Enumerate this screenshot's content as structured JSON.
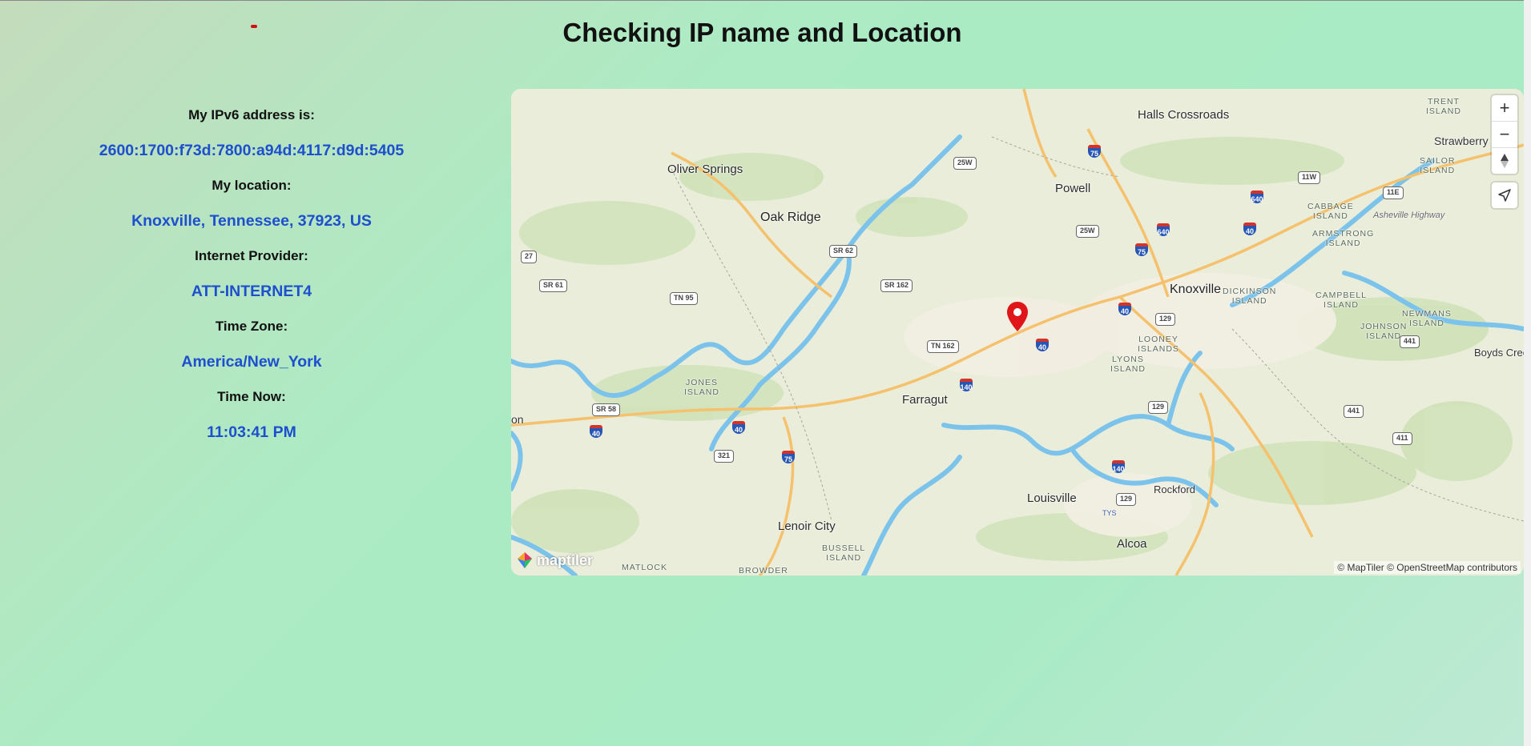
{
  "page": {
    "title": "Checking IP name and Location"
  },
  "info": {
    "ipv6_label": "My IPv6 address is:",
    "ipv6_value": "2600:1700:f73d:7800:a94d:4117:d9d:5405",
    "location_label": "My location:",
    "location_value": "Knoxville, Tennessee, 37923, US",
    "provider_label": "Internet Provider:",
    "provider_value": "ATT-INTERNET4",
    "timezone_label": "Time Zone:",
    "timezone_value": "America/New_York",
    "time_label": "Time Now:",
    "time_value": "11:03:41 PM"
  },
  "map": {
    "controls": {
      "zoom_in": "+",
      "zoom_out": "−"
    },
    "labels": {
      "halls_crossroads": "Halls Crossroads",
      "oliver_springs": "Oliver Springs",
      "oak_ridge": "Oak Ridge",
      "powell": "Powell",
      "knoxville": "Knoxville",
      "farragut": "Farragut",
      "louisville": "Louisville",
      "lenoir_city": "Lenoir City",
      "alcoa": "Alcoa",
      "rockford": "Rockford",
      "strawberry": "Strawberry P",
      "boyds_creek": "Boyds Creek",
      "on": "on",
      "trent_island": "TRENT\nISLAND",
      "sailor_island": "SAILOR\nISLAND",
      "cabbage_island": "CABBAGE\nISLAND",
      "armstrong_island": "ARMSTRONG\nISLAND",
      "dickinson_island": "DICKINSON\nISLAND",
      "campbell_island": "CAMPBELL\nISLAND",
      "newmans_island": "NEWMANS\nISLAND",
      "johnson_island": "JOHNSON\nISLAND",
      "looney_islands": "LOONEY\nISLANDS",
      "lyons_island": "LYONS\nISLAND",
      "jones_island": "JONES\nISLAND",
      "bussell_island": "BUSSELL\nISLAND",
      "matlock": "MATLOCK",
      "browder": "BROWDER",
      "asheville_highway": "Asheville Highway",
      "tys": "TYS"
    },
    "shields": {
      "i75_a": "75",
      "i640_a": "640",
      "i640_b": "640",
      "i40_a": "40",
      "i75_b": "75",
      "i40_b": "40",
      "i40_c": "40",
      "i140_a": "140",
      "i40_d": "40",
      "i40_e": "40",
      "i75_c": "75",
      "i140_b": "140",
      "us25w_a": "25W",
      "us25w_b": "25W",
      "us11w": "11W",
      "us11e": "11E",
      "sr62": "SR 62",
      "sr162": "SR 162",
      "tn162": "TN 162",
      "tn95": "TN 95",
      "sr61": "SR 61",
      "us27": "27",
      "sr58": "SR 58",
      "us321": "321",
      "us129_a": "129",
      "us441_a": "441",
      "us129_b": "129",
      "us441_b": "441",
      "us411": "411",
      "us129_c": "129"
    },
    "attribution": "© MapTiler © OpenStreetMap contributors",
    "logo": "maptiler"
  }
}
